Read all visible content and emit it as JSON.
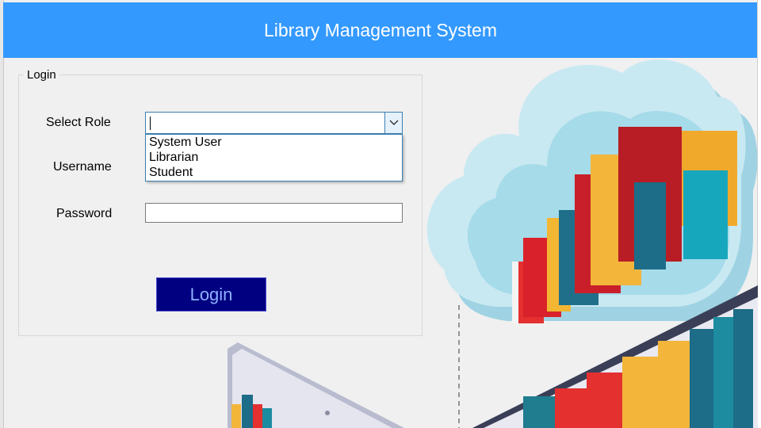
{
  "window": {
    "title": "Library Management System"
  },
  "colors": {
    "header": "#3399ff",
    "login_button_bg": "#000080",
    "login_button_text": "#8fb0ff"
  },
  "login_group": {
    "legend": "Login",
    "select_role_label": "Select Role",
    "select_role_value": "",
    "role_options": [
      "System User",
      "Librarian",
      "Student"
    ],
    "username_label": "Username",
    "username_value": "",
    "password_label": "Password",
    "password_value": "",
    "login_button_label": "Login"
  },
  "illustration": {
    "icon": "library-cloud-books-illustration"
  }
}
